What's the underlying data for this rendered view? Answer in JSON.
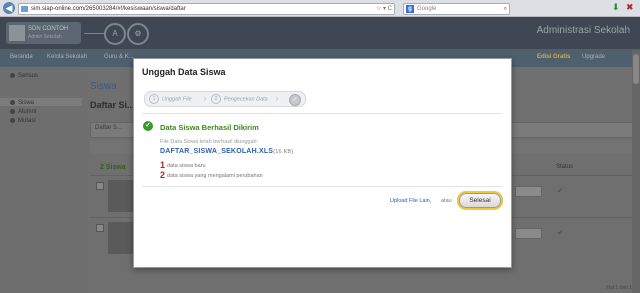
{
  "browser": {
    "url": "sim.siap-online.com/265003284/#!/kesiswaan/siswa/daftar",
    "url_actions": "☆ ▾ C",
    "search_placeholder": "Google",
    "search_icon": "magnifier-icon",
    "home_icon": "home-icon"
  },
  "header": {
    "user_name": "SDN CONTOH",
    "user_role": "Admin Sekolah",
    "circle1_icon": "A",
    "circle2_icon": "⚙",
    "brand": "Administrasi Sekolah"
  },
  "nav": {
    "items": [
      "Beranda",
      "Kelola Sekolah",
      "Guru & K..."
    ],
    "edisi": "Edisi Gratis",
    "upgrade": "Upgrade"
  },
  "sidebar": {
    "items": [
      "Sensus",
      "Siswa",
      "Alumni",
      "Mutasi"
    ]
  },
  "main": {
    "title": "Siswa",
    "subtitle": "Daftar Si...",
    "tab_label": "Daftar S...",
    "count": "2",
    "count_label": "Siswa",
    "status_header": "Status",
    "pager": "Hal 1 dari 1"
  },
  "modal": {
    "title": "Unggah Data Siswa",
    "steps": [
      {
        "num": "1",
        "label": "Unggah File"
      },
      {
        "num": "2",
        "label": "Pengecekan Data"
      }
    ],
    "step3_icon": "✓",
    "success_title": "Data Siswa Berhasil Dikirim",
    "file_note": "File Data Siswa telah berhasil diunggah:",
    "file_name": "DAFTAR_SISWA_SEKOLAH.XLS",
    "file_size": "(16 KB)",
    "stats": [
      {
        "num": "1",
        "label": "data siswa baru"
      },
      {
        "num": "2",
        "label": "data siswa yang mengalami perubahan"
      }
    ],
    "upload_other": "Upload File Lain,",
    "atau": "atau",
    "done_button": "Selesai"
  },
  "colors": {
    "success": "#3a8a1c",
    "link": "#2a5fb0",
    "accent_ring": "#f0c63a",
    "stat_number": "#b02a1c"
  }
}
